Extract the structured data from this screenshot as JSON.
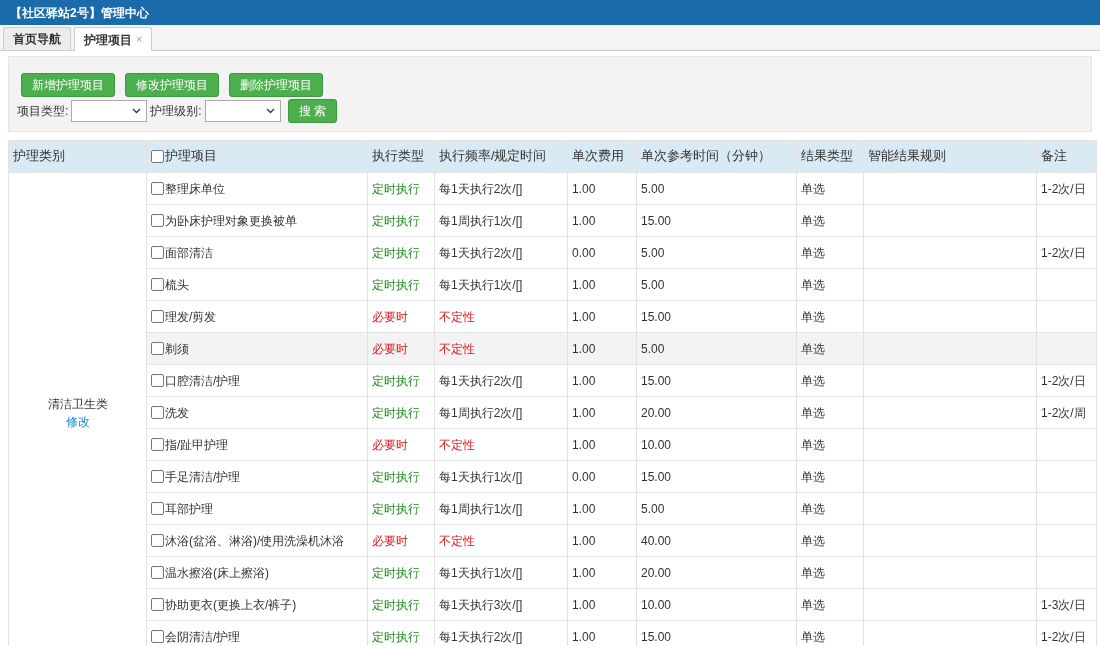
{
  "header": {
    "title": "【社区驿站2号】管理中心"
  },
  "tabs": [
    {
      "label": "首页导航",
      "selected": false
    },
    {
      "label": "护理项目",
      "selected": true,
      "close": "×"
    }
  ],
  "toolbar": {
    "buttons": [
      "新增护理项目",
      "修改护理项目",
      "删除护理项目"
    ],
    "filters": [
      {
        "label": "项目类型:"
      },
      {
        "label": "护理级别:"
      }
    ],
    "search_button": "搜 索"
  },
  "table": {
    "columns": [
      "护理类别",
      "护理项目",
      "执行类型",
      "执行频率/规定时间",
      "单次费用",
      "单次参考时间（分钟）",
      "结果类型",
      "智能结果规则",
      "备注"
    ],
    "header_checkbox": {
      "checked": false
    },
    "category": {
      "name": "清洁卫生类",
      "action": "修改"
    },
    "rows": [
      {
        "item": "整理床单位",
        "checked": false,
        "selected": false,
        "kind": "scheduled",
        "exec_type": "定时执行",
        "frequency": "每1天执行2次/[]",
        "fee": "1.00",
        "ref_time": "5.00",
        "result_type": "单选",
        "note": "1-2次/日"
      },
      {
        "item": "为卧床护理对象更换被单",
        "checked": false,
        "selected": false,
        "kind": "scheduled",
        "exec_type": "定时执行",
        "frequency": "每1周执行1次/[]",
        "fee": "1.00",
        "ref_time": "15.00",
        "result_type": "单选"
      },
      {
        "item": "面部清洁",
        "checked": false,
        "selected": false,
        "kind": "scheduled",
        "exec_type": "定时执行",
        "frequency": "每1天执行2次/[]",
        "fee": "0.00",
        "ref_time": "5.00",
        "result_type": "单选",
        "note": "1-2次/日"
      },
      {
        "item": "梳头",
        "checked": false,
        "selected": false,
        "kind": "scheduled",
        "exec_type": "定时执行",
        "frequency": "每1天执行1次/[]",
        "fee": "1.00",
        "ref_time": "5.00",
        "result_type": "单选"
      },
      {
        "item": "理发/剪发",
        "checked": false,
        "selected": false,
        "kind": "as_needed",
        "exec_type": "必要时",
        "frequency": "不定性",
        "fee": "1.00",
        "ref_time": "15.00",
        "result_type": "单选"
      },
      {
        "item": "剃须",
        "checked": false,
        "selected": true,
        "kind": "as_needed",
        "exec_type": "必要时",
        "frequency": "不定性",
        "fee": "1.00",
        "ref_time": "5.00",
        "result_type": "单选"
      },
      {
        "item": "口腔清洁/护理",
        "checked": false,
        "selected": false,
        "kind": "scheduled",
        "exec_type": "定时执行",
        "frequency": "每1天执行2次/[]",
        "fee": "1.00",
        "ref_time": "15.00",
        "result_type": "单选",
        "note": "1-2次/日"
      },
      {
        "item": "洗发",
        "checked": false,
        "selected": false,
        "kind": "scheduled",
        "exec_type": "定时执行",
        "frequency": "每1周执行2次/[]",
        "fee": "1.00",
        "ref_time": "20.00",
        "result_type": "单选",
        "note": "1-2次/周"
      },
      {
        "item": "指/趾甲护理",
        "checked": false,
        "selected": false,
        "kind": "as_needed",
        "exec_type": "必要时",
        "frequency": "不定性",
        "fee": "1.00",
        "ref_time": "10.00",
        "result_type": "单选"
      },
      {
        "item": "手足清洁/护理",
        "checked": false,
        "selected": false,
        "kind": "scheduled",
        "exec_type": "定时执行",
        "frequency": "每1天执行1次/[]",
        "fee": "0.00",
        "ref_time": "15.00",
        "result_type": "单选"
      },
      {
        "item": "耳部护理",
        "checked": false,
        "selected": false,
        "kind": "scheduled",
        "exec_type": "定时执行",
        "frequency": "每1周执行1次/[]",
        "fee": "1.00",
        "ref_time": "5.00",
        "result_type": "单选"
      },
      {
        "item": "沐浴(盆浴、淋浴)/使用洗澡机沐浴",
        "checked": false,
        "selected": false,
        "kind": "as_needed",
        "exec_type": "必要时",
        "frequency": "不定性",
        "fee": "1.00",
        "ref_time": "40.00",
        "result_type": "单选"
      },
      {
        "item": "温水擦浴(床上擦浴)",
        "checked": false,
        "selected": false,
        "kind": "scheduled",
        "exec_type": "定时执行",
        "frequency": "每1天执行1次/[]",
        "fee": "1.00",
        "ref_time": "20.00",
        "result_type": "单选"
      },
      {
        "item": "协助更衣(更换上衣/裤子)",
        "checked": false,
        "selected": false,
        "kind": "scheduled",
        "exec_type": "定时执行",
        "frequency": "每1天执行3次/[]",
        "fee": "1.00",
        "ref_time": "10.00",
        "result_type": "单选",
        "note": "1-3次/日"
      },
      {
        "item": "会阴清洁/护理",
        "checked": false,
        "selected": false,
        "kind": "scheduled",
        "exec_type": "定时执行",
        "frequency": "每1天执行2次/[]",
        "fee": "1.00",
        "ref_time": "15.00",
        "result_type": "单选",
        "note": "1-2次/日"
      }
    ]
  }
}
